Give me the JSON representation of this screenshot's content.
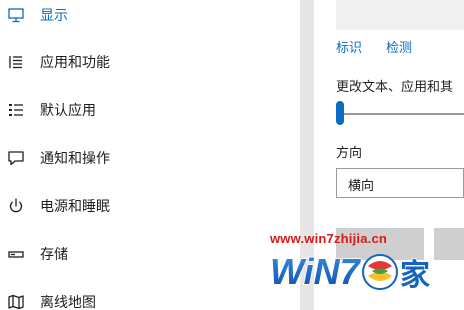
{
  "sidebar": {
    "items": [
      {
        "label": "显示",
        "icon": "monitor-icon",
        "active": true
      },
      {
        "label": "应用和功能",
        "icon": "apps-list-icon",
        "active": false
      },
      {
        "label": "默认应用",
        "icon": "default-apps-icon",
        "active": false
      },
      {
        "label": "通知和操作",
        "icon": "notification-icon",
        "active": false
      },
      {
        "label": "电源和睡眠",
        "icon": "power-icon",
        "active": false
      },
      {
        "label": "存储",
        "icon": "storage-icon",
        "active": false
      },
      {
        "label": "离线地图",
        "icon": "map-icon",
        "active": false
      }
    ]
  },
  "content": {
    "links": {
      "identify": "标识",
      "detect": "检测"
    },
    "scale_label": "更改文本、应用和其",
    "scale_percent": 0,
    "orientation_label": "方向",
    "orientation_value": "横向"
  },
  "watermark": {
    "url": "www.win7zhijia.cn",
    "logo_text": "WiN7.之家"
  },
  "colors": {
    "accent": "#0a6cbf",
    "watermark_red": "#d81919",
    "watermark_blue": "#1565c0"
  }
}
